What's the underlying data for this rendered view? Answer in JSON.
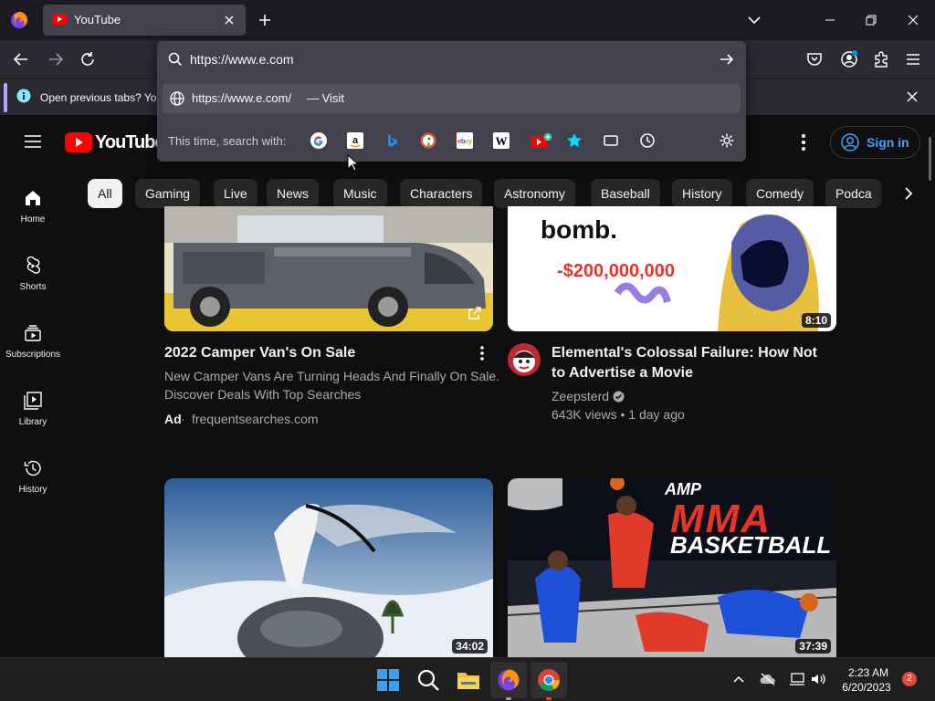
{
  "browser": {
    "tab_title": "YouTube",
    "url_value": "https://www.e.com",
    "suggestion_url": "https://www.e.com/",
    "suggestion_action": "— Visit",
    "search_with_label": "This time, search with:",
    "engines": [
      "Google",
      "Amazon",
      "Bing",
      "DuckDuckGo",
      "eBay",
      "Wikipedia",
      "YouTube",
      "Bookmarks",
      "Tabs",
      "History"
    ],
    "notification": "Open previous tabs? You"
  },
  "youtube": {
    "logo_text": "YouTube",
    "sign_in": "Sign in",
    "chips": [
      "All",
      "Gaming",
      "Live",
      "News",
      "Music",
      "Characters",
      "Astronomy",
      "Baseball",
      "History",
      "Comedy",
      "Podca"
    ],
    "sidebar": [
      {
        "label": "Home",
        "icon": "home-icon"
      },
      {
        "label": "Shorts",
        "icon": "shorts-icon"
      },
      {
        "label": "Subscriptions",
        "icon": "subscriptions-icon"
      },
      {
        "label": "Library",
        "icon": "library-icon"
      },
      {
        "label": "History",
        "icon": "history-icon"
      }
    ],
    "videos": [
      {
        "title": "2022 Camper Van's On Sale",
        "desc1": "New Camper Vans Are Turning Heads And Finally On Sale.",
        "desc2": "Discover Deals With Top Searches",
        "ad_label": "Ad",
        "ad_source": "frequentsearches.com"
      },
      {
        "title1": "Elemental's Colossal Failure: How Not",
        "title2": "to Advertise a Movie",
        "channel": "Zeepsterd",
        "meta": "643K views • 1 day ago",
        "duration": "8:10",
        "thumb_text1": "bomb.",
        "thumb_text2": "-$200,000,000"
      },
      {
        "duration": "34:02"
      },
      {
        "duration": "37:39",
        "thumb_text1": "AMP",
        "thumb_text2": "MMA",
        "thumb_text3": "BASKETBALL"
      }
    ]
  },
  "taskbar": {
    "time": "2:23 AM",
    "date": "6/20/2023",
    "notification_count": "2"
  },
  "colors": {
    "accent_blue": "#3ea6ff",
    "youtube_red": "#ff0000",
    "browser_panel": "#42414d"
  }
}
